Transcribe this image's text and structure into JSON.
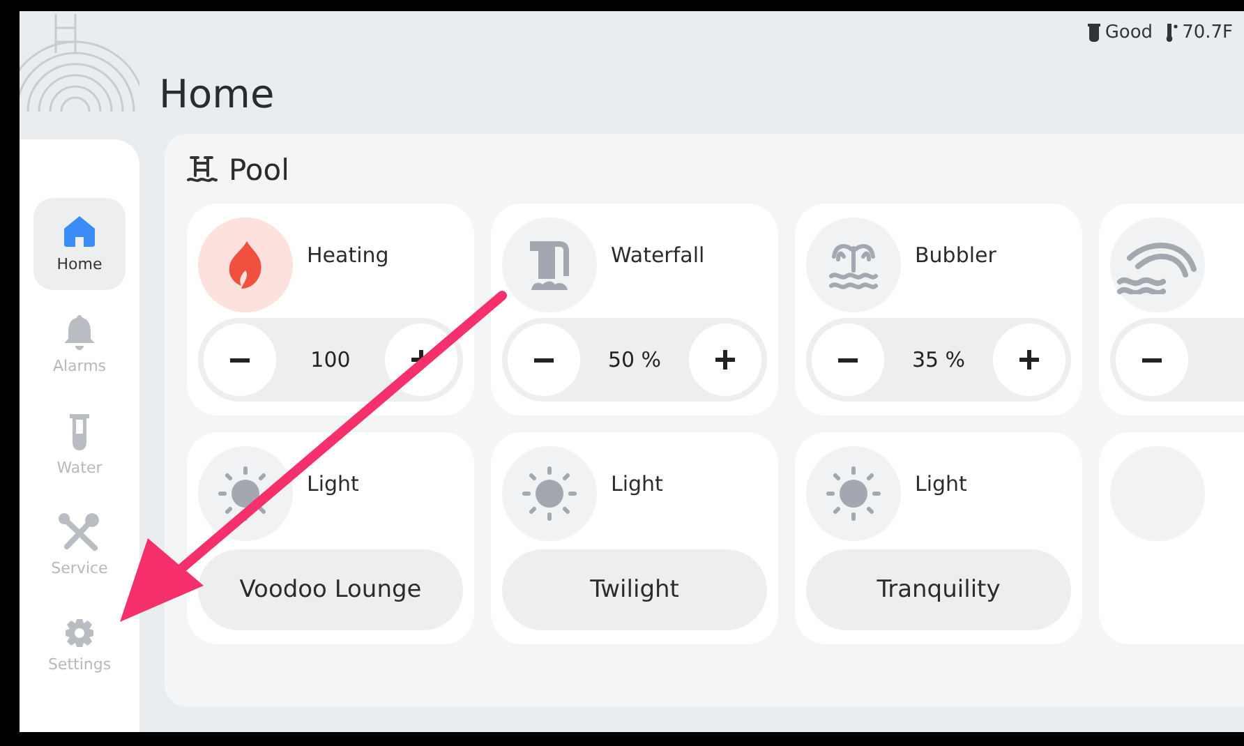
{
  "status": {
    "water": "Good",
    "temperature": "70.7F"
  },
  "sidebar": {
    "items": [
      {
        "label": "Home",
        "selected": true
      },
      {
        "label": "Alarms",
        "selected": false
      },
      {
        "label": "Water",
        "selected": false
      },
      {
        "label": "Service",
        "selected": false
      },
      {
        "label": "Settings",
        "selected": false
      }
    ]
  },
  "title": "Home",
  "panel": {
    "title": "Pool",
    "cards": [
      {
        "kind": "stepper",
        "label": "Heating",
        "on": true,
        "value": "100"
      },
      {
        "kind": "stepper",
        "label": "Waterfall",
        "on": false,
        "value": "50 %"
      },
      {
        "kind": "stepper",
        "label": "Bubbler",
        "on": false,
        "value": "35 %"
      },
      {
        "kind": "stepper",
        "on": false
      },
      {
        "kind": "scene",
        "label": "Light",
        "scene": "Voodoo Lounge"
      },
      {
        "kind": "scene",
        "label": "Light",
        "scene": "Twilight"
      },
      {
        "kind": "scene",
        "label": "Light",
        "scene": "Tranquility"
      },
      {
        "kind": "scene"
      }
    ]
  }
}
